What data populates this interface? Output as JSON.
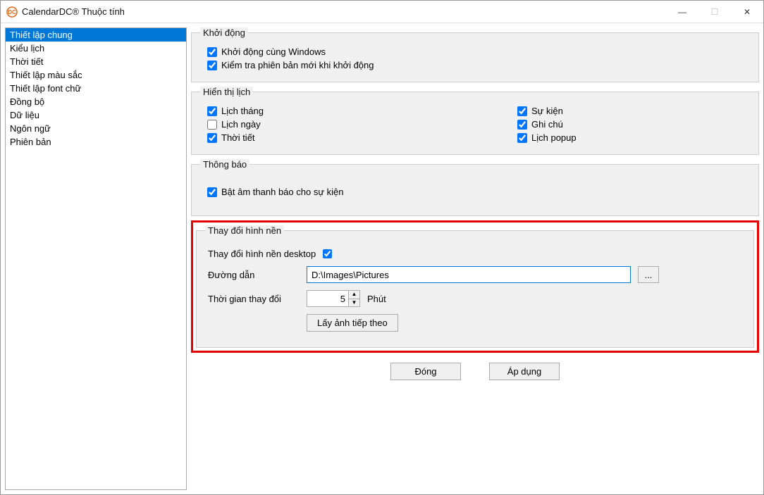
{
  "window": {
    "title": "CalendarDC® Thuộc tính",
    "icon_text": "DC"
  },
  "sidebar": {
    "items": [
      "Thiết lập chung",
      "Kiểu lịch",
      "Thời tiết",
      "Thiết lập màu sắc",
      "Thiết lập font chữ",
      "Đồng bộ",
      "Dữ liệu",
      "Ngôn ngữ",
      "Phiên bản"
    ],
    "selected_index": 0
  },
  "groups": {
    "startup": {
      "legend": "Khởi động",
      "start_with_windows": {
        "label": "Khởi động cùng Windows",
        "checked": true
      },
      "check_update": {
        "label": "Kiểm tra phiên bản mới khi khởi động",
        "checked": true
      }
    },
    "display": {
      "legend": "Hiển thị lịch",
      "month_calendar": {
        "label": "Lịch tháng",
        "checked": true
      },
      "day_calendar": {
        "label": "Lịch ngày",
        "checked": false
      },
      "weather": {
        "label": "Thời tiết",
        "checked": true
      },
      "events": {
        "label": "Sự kiện",
        "checked": true
      },
      "notes": {
        "label": "Ghi chú",
        "checked": true
      },
      "popup_calendar": {
        "label": "Lịch popup",
        "checked": true
      }
    },
    "notify": {
      "legend": "Thông báo",
      "sound": {
        "label": "Bật âm thanh báo cho sự kiện",
        "checked": true
      }
    },
    "wallpaper": {
      "legend": "Thay đổi hình nền",
      "enable": {
        "label": "Thay đổi hình nền desktop",
        "checked": true
      },
      "path_label": "Đường dẫn",
      "path_value": "D:\\Images\\Pictures",
      "browse_label": "...",
      "interval_label": "Thời gian thay đổi",
      "interval_value": "5",
      "interval_unit": "Phút",
      "next_image_label": "Lấy ảnh tiếp theo"
    }
  },
  "buttons": {
    "close": "Đóng",
    "apply": "Áp dụng"
  },
  "icons": {
    "minimize": "—",
    "maximize": "☐",
    "close": "✕"
  }
}
